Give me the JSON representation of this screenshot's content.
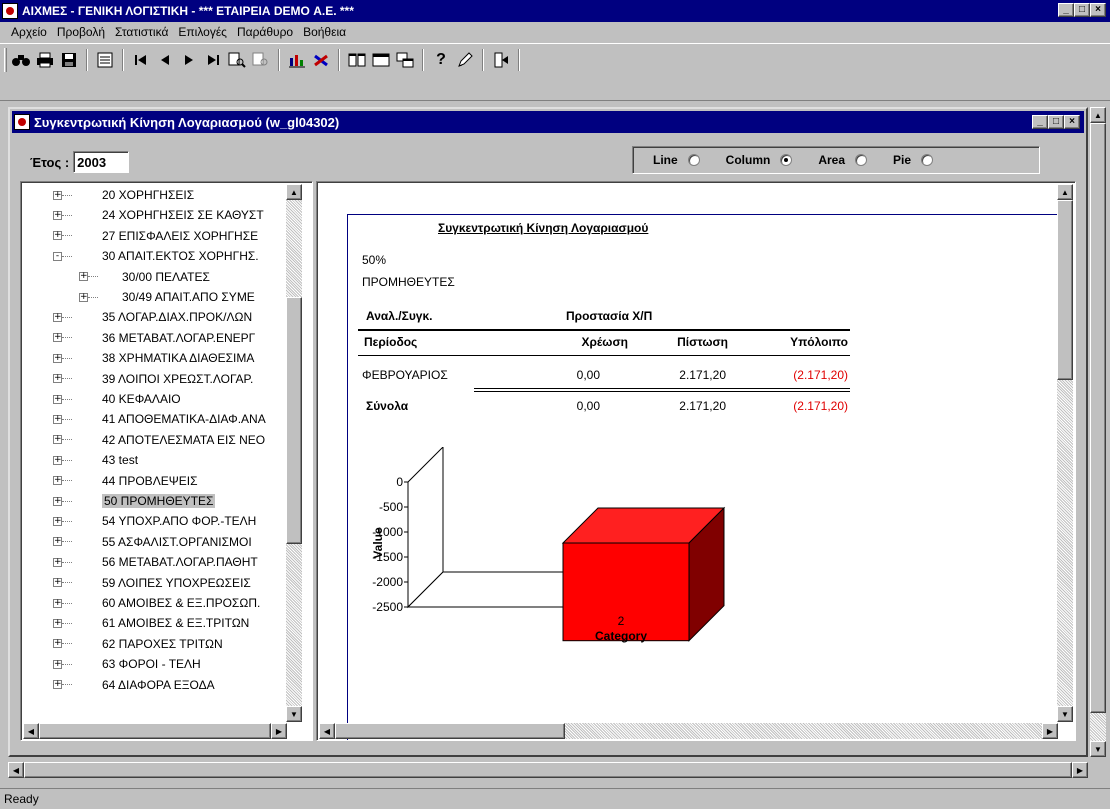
{
  "window": {
    "title": "ΑΙΧΜΕΣ - ΓΕΝΙΚΗ ΛΟΓΙΣΤΙΚΗ  -  *** ΕΤΑΙΡΕΙΑ DEMO Α.Ε.   ***"
  },
  "menu": [
    "Αρχείο",
    "Προβολή",
    "Στατιστικά",
    "Επιλογές",
    "Παράθυρο",
    "Βοήθεια"
  ],
  "toolbar": {
    "buttons": [
      "binoculars-icon",
      "printer-icon",
      "save-icon",
      "list-icon",
      "first-record-icon",
      "previous-record-icon",
      "next-record-icon",
      "last-record-icon",
      "zoom-icon",
      "filter-icon",
      "chart-icon",
      "excel-icon",
      "columns-icon",
      "window-icon",
      "cascade-icon",
      "help-icon",
      "pen-icon",
      "exit-icon"
    ]
  },
  "child_window": {
    "title": "Συγκεντρωτική Κίνηση Λογαριασμού   (w_gl04302)",
    "year_label": "Έτος :",
    "year_value": "2003",
    "chart_types": [
      {
        "label": "Line",
        "checked": false
      },
      {
        "label": "Column",
        "checked": true
      },
      {
        "label": "Area",
        "checked": false
      },
      {
        "label": "Pie",
        "checked": false
      }
    ]
  },
  "tree": {
    "items": [
      {
        "label": "20 ΧΟΡΗΓΗΣΕΙΣ",
        "level": 0,
        "expander": "+"
      },
      {
        "label": "24 ΧΟΡΗΓΗΣΕΙΣ ΣΕ ΚΑΘΥΣΤ",
        "level": 0,
        "expander": "+"
      },
      {
        "label": "27 ΕΠΙΣΦΑΛΕΙΣ ΧΟΡΗΓΗΣΕ",
        "level": 0,
        "expander": "+"
      },
      {
        "label": "30 ΑΠΑΙΤ.ΕΚΤΟΣ ΧΟΡΗΓΗΣ.",
        "level": 0,
        "expander": "-"
      },
      {
        "label": "30/00 ΠΕΛΑΤΕΣ",
        "level": 1,
        "expander": "+"
      },
      {
        "label": "30/49 ΑΠΑΙΤ.ΑΠΟ ΣΥΜΕ",
        "level": 1,
        "expander": "+"
      },
      {
        "label": "35 ΛΟΓΑΡ.ΔΙΑΧ.ΠΡΟΚ/ΛΩΝ",
        "level": 0,
        "expander": "+"
      },
      {
        "label": "36 ΜΕΤΑΒΑΤ.ΛΟΓΑΡ.ΕΝΕΡΓ",
        "level": 0,
        "expander": "+"
      },
      {
        "label": "38 ΧΡΗΜΑΤΙΚΑ ΔΙΑΘΕΣΙΜΑ",
        "level": 0,
        "expander": "+"
      },
      {
        "label": "39 ΛΟΙΠΟΙ ΧΡΕΩΣΤ.ΛΟΓΑΡ.",
        "level": 0,
        "expander": "+"
      },
      {
        "label": "40 ΚΕΦΑΛΑΙΟ",
        "level": 0,
        "expander": "+"
      },
      {
        "label": "41 ΑΠΟΘΕΜΑΤΙΚΑ-ΔΙΑΦ.ΑΝΑ",
        "level": 0,
        "expander": "+"
      },
      {
        "label": "42 ΑΠΟΤΕΛΕΣΜΑΤΑ ΕΙΣ ΝΕΟ",
        "level": 0,
        "expander": "+"
      },
      {
        "label": "43 test",
        "level": 0,
        "expander": "+"
      },
      {
        "label": "44 ΠΡΟΒΛΕΨΕΙΣ",
        "level": 0,
        "expander": "+"
      },
      {
        "label": "50 ΠΡΟΜΗΘΕΥΤΕΣ",
        "level": 0,
        "expander": "+",
        "selected": true
      },
      {
        "label": "54 ΥΠΟΧΡ.ΑΠΟ ΦΟΡ.-ΤΕΛΗ",
        "level": 0,
        "expander": "+"
      },
      {
        "label": "55 ΑΣΦΑΛΙΣΤ.ΟΡΓΑΝΙΣΜΟΙ",
        "level": 0,
        "expander": "+"
      },
      {
        "label": "56 ΜΕΤΑΒΑΤ.ΛΟΓΑΡ.ΠΑΘΗΤ",
        "level": 0,
        "expander": "+"
      },
      {
        "label": "59 ΛΟΙΠΕΣ ΥΠΟΧΡΕΩΣΕΙΣ",
        "level": 0,
        "expander": "+"
      },
      {
        "label": "60 ΑΜΟΙΒΕΣ & ΕΞ.ΠΡΟΣΩΠ.",
        "level": 0,
        "expander": "+"
      },
      {
        "label": "61 ΑΜΟΙΒΕΣ & ΕΞ.ΤΡΙΤΩΝ",
        "level": 0,
        "expander": "+"
      },
      {
        "label": "62 ΠΑΡΟΧΕΣ ΤΡΙΤΩΝ",
        "level": 0,
        "expander": "+"
      },
      {
        "label": "63 ΦΟΡΟΙ - ΤΕΛΗ",
        "level": 0,
        "expander": "+"
      },
      {
        "label": "64 ΔΙΑΦΟΡΑ ΕΞΟΔΑ",
        "level": 0,
        "expander": "+"
      }
    ]
  },
  "report": {
    "title": "Συγκεντρωτική  Κίνηση  Λογαριασμού",
    "account_code": "50%",
    "account_name": "ΠΡΟΜΗΘΕΥΤΕΣ",
    "group_label": "Αναλ./Συγκ.",
    "protection_label": "Προστασία Χ/Π",
    "columns": [
      "Περίοδος",
      "Χρέωση",
      "Πίστωση",
      "Υπόλοιπο"
    ],
    "rows": [
      {
        "period": "ΦΕΒΡΟΥΑΡΙΟΣ",
        "debit": "0,00",
        "credit": "2.171,20",
        "balance": "(2.171,20)"
      }
    ],
    "totals": {
      "label": "Σύνολα",
      "debit": "0,00",
      "credit": "2.171,20",
      "balance": "(2.171,20)"
    }
  },
  "chart_data": {
    "type": "bar",
    "categories": [
      "2"
    ],
    "values": [
      -2171.2
    ],
    "xlabel": "Category",
    "ylabel": "Value",
    "ylim": [
      -2500,
      0
    ],
    "yticks": [
      "0",
      "-500",
      "-1000",
      "-1500",
      "-2000",
      "-2500"
    ],
    "color": "#ff0000"
  },
  "status": {
    "text": "Ready"
  }
}
